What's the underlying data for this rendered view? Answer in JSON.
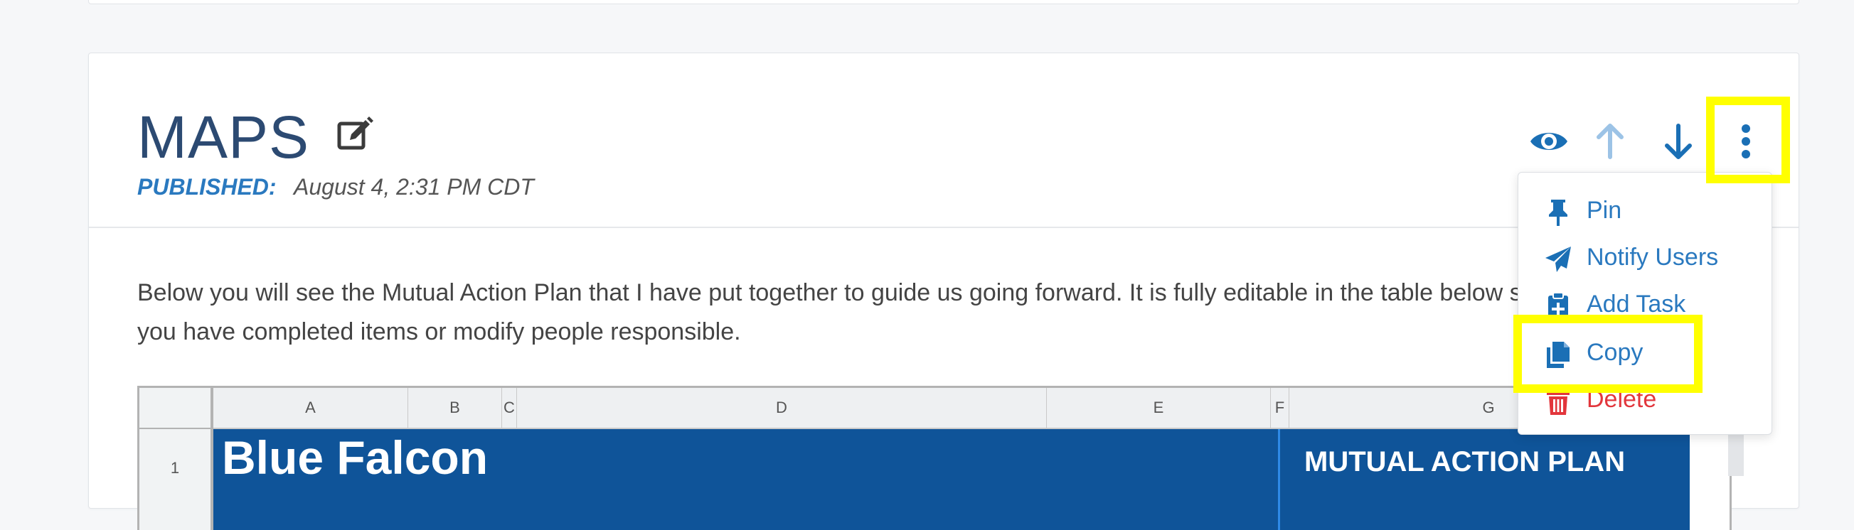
{
  "post": {
    "title": "MAPS",
    "published_label": "PUBLISHED:",
    "published_date": "August 4, 2:31 PM CDT",
    "body": "Below you will see the Mutual Action Plan that I have put together to guide us going forward. It is fully editable in the table below so please mark when you have completed items or modify people responsible."
  },
  "actions": {
    "icons": [
      "eye-icon",
      "arrow-up-icon",
      "arrow-down-icon",
      "more-vertical-icon"
    ]
  },
  "menu": {
    "items": [
      {
        "label": "Pin",
        "icon": "pin-icon"
      },
      {
        "label": "Notify Users",
        "icon": "paper-plane-icon"
      },
      {
        "label": "Add Task",
        "icon": "clipboard-plus-icon"
      },
      {
        "label": "Copy",
        "icon": "copy-icon"
      },
      {
        "label": "Delete",
        "icon": "trash-icon"
      }
    ]
  },
  "sheet": {
    "columns": [
      "A",
      "B",
      "C",
      "D",
      "E",
      "F",
      "G"
    ],
    "row_number": "1",
    "banner_title": "Blue Falcon",
    "banner_subtitle": "MUTUAL ACTION PLAN"
  },
  "colors": {
    "title": "#2c4a72",
    "accent": "#2a79bf",
    "danger": "#e2363c",
    "banner": "#0f5499",
    "highlight": "#ffff00"
  }
}
